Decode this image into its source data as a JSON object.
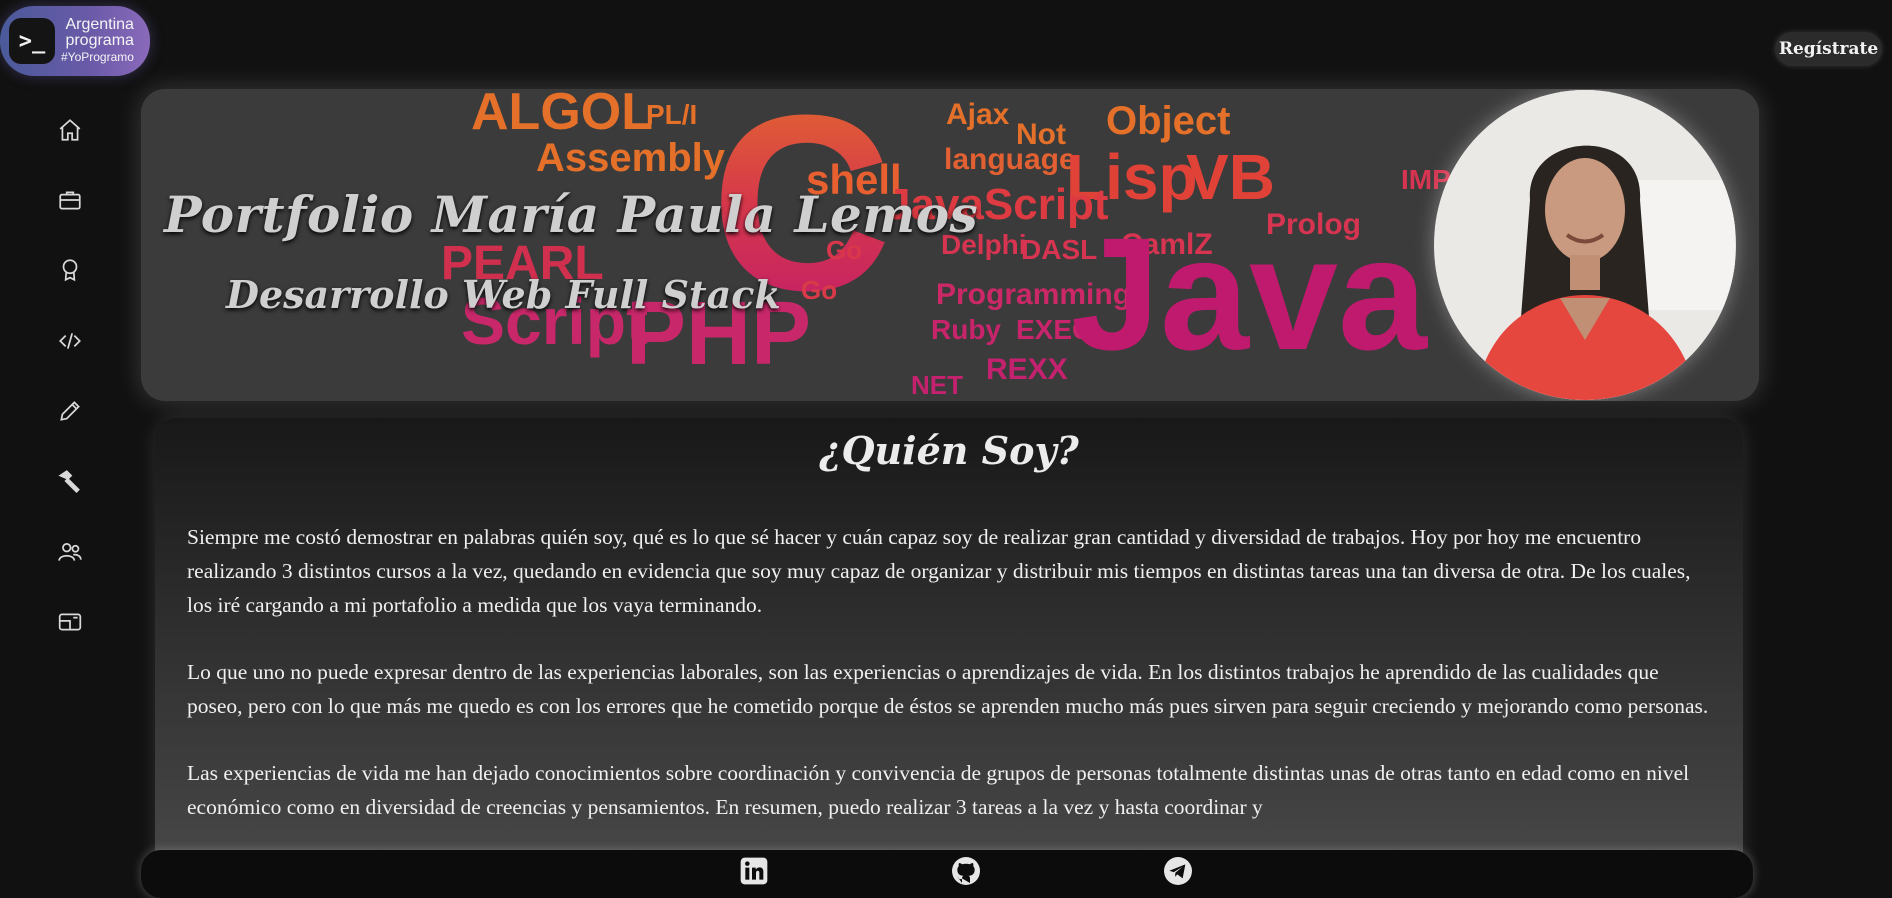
{
  "logo": {
    "line1": "Argentina",
    "line2": "programa",
    "line3": "#YoProgramo",
    "terminal_glyph": ">_"
  },
  "header": {
    "register_label": "Regístrate"
  },
  "sidebar": {
    "items": [
      {
        "icon": "home-icon"
      },
      {
        "icon": "briefcase-icon"
      },
      {
        "icon": "award-icon"
      },
      {
        "icon": "code-icon"
      },
      {
        "icon": "pencil-icon"
      },
      {
        "icon": "hammer-icon"
      },
      {
        "icon": "people-icon"
      },
      {
        "icon": "contact-card-icon"
      }
    ]
  },
  "banner": {
    "title": "Portfolio María Paula Lemos",
    "subtitle": "Desarrollo Web Full Stack",
    "word_cloud": [
      "ALGOL",
      "PL/I",
      "Assembly",
      "C",
      "shell",
      "Ajax",
      "Not",
      "language",
      "Object",
      "Lisp",
      "VB",
      "JavaScript",
      "Go",
      "Delphi",
      "DASL",
      "CamlZ",
      "Prolog",
      "IMP",
      "PEARL",
      "Script",
      "PHP",
      "Programming",
      "Ruby",
      "EXEC",
      "REXX",
      "NET",
      "Java",
      "Go"
    ]
  },
  "about": {
    "title": "¿Quién Soy?",
    "paragraphs": [
      "Siempre me costó demostrar en palabras quién soy, qué es lo que sé hacer y cuán capaz soy de realizar gran cantidad y diversidad de trabajos. Hoy por hoy me encuentro realizando 3 distintos cursos a la vez, quedando en evidencia que soy muy capaz de organizar y distribuir mis tiempos en distintas tareas una tan diversa de otra. De los cuales, los iré cargando a mi portafolio a medida que los vaya terminando.",
      "Lo que uno no puede expresar dentro de las experiencias laborales, son las experiencias o aprendizajes de vida. En los distintos trabajos he aprendido de las cualidades que poseo, pero con lo que más me quedo es con los errores que he cometido porque de éstos se aprenden mucho más pues sirven para seguir creciendo y mejorando como personas.",
      "Las experiencias de vida me han dejado conocimientos sobre coordinación y convivencia de grupos de personas totalmente distintas unas de otras tanto en edad como en nivel económico como en diversidad de creencias y pensamientos. En resumen, puedo realizar 3 tareas a la vez y hasta coordinar y"
    ]
  },
  "footer": {
    "icons": [
      "linkedin-icon",
      "github-icon",
      "telegram-icon"
    ]
  },
  "colors": {
    "background": "#111111",
    "cloud_orange": "#e0622a",
    "cloud_magenta": "#c8206a",
    "text": "#f0f0f0"
  }
}
